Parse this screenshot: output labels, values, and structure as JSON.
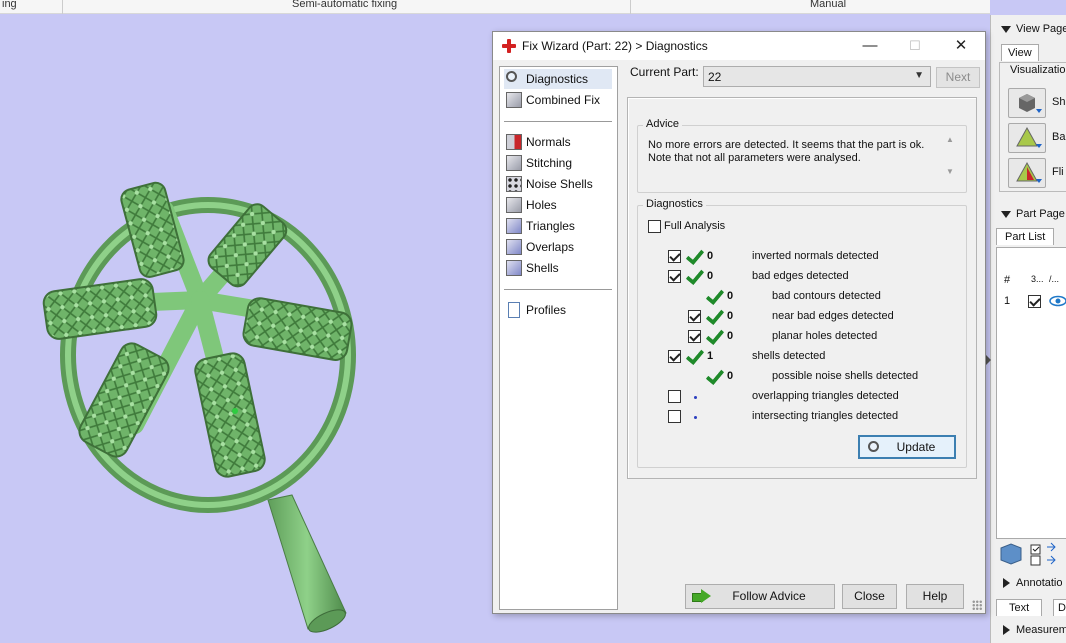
{
  "topbar": {
    "item1": "ing",
    "item2": "Semi-automatic fixing",
    "item3": "Manual"
  },
  "dialog": {
    "title": "Fix Wizard (Part: 22) > Diagnostics",
    "minimize": "—",
    "maximize": "☐",
    "close": "✕",
    "nav": {
      "diagnostics": "Diagnostics",
      "combined_fix": "Combined Fix",
      "normals": "Normals",
      "stitching": "Stitching",
      "noise_shells": "Noise Shells",
      "holes": "Holes",
      "triangles": "Triangles",
      "overlaps": "Overlaps",
      "shells": "Shells",
      "profiles": "Profiles"
    },
    "current_part_label": "Current Part:",
    "current_part_value": "22",
    "next_label": "Next",
    "advice": {
      "title": "Advice",
      "text_line1": "No more errors are detected. It seems that the part is ok.",
      "text_line2": "Note that not all parameters were analysed."
    },
    "diagnostics": {
      "title": "Diagnostics",
      "full_analysis": "Full Analysis",
      "rows": [
        {
          "count": "0",
          "label": "inverted normals detected"
        },
        {
          "count": "0",
          "label": "bad edges detected"
        },
        {
          "count": "0",
          "label": "bad contours detected"
        },
        {
          "count": "0",
          "label": "near bad edges detected"
        },
        {
          "count": "0",
          "label": "planar holes detected"
        },
        {
          "count": "1",
          "label": "shells detected"
        },
        {
          "count": "0",
          "label": "possible noise shells detected"
        },
        {
          "count": "",
          "label": "overlapping triangles detected"
        },
        {
          "count": "",
          "label": "intersecting triangles detected"
        }
      ],
      "update_label": "Update"
    },
    "follow_advice_label": "Follow Advice",
    "close_label": "Close",
    "help_label": "Help"
  },
  "rightpanel": {
    "view_pages": "View Page",
    "view_tab": "View",
    "visualization": "Visualization",
    "btn1": "Sh",
    "btn2": "Ba",
    "btn3": "Fli",
    "part_pages": "Part Page",
    "part_list_tab": "Part List",
    "col_hash": "#",
    "col2": "3...",
    "col3": "/...",
    "row1_num": "1",
    "annotations": "Annotatio",
    "text_tab": "Text",
    "d_tab": "D",
    "measurements": "Measurem"
  },
  "colors": {
    "viewport_bg": "#c8c8f5",
    "model_green": "#7fc77a",
    "accent_check": "#1f8a2a",
    "cross_red": "#d32121"
  }
}
